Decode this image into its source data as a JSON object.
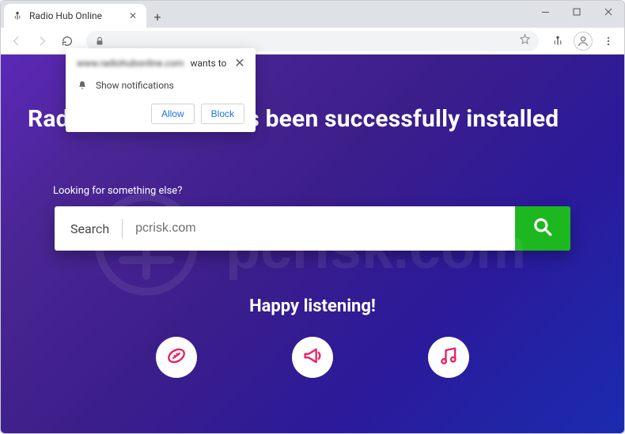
{
  "browser": {
    "tab_title": "Radio Hub Online",
    "newtab_glyph": "+",
    "win_min": "—",
    "win_max": "▢",
    "win_close": "✕",
    "tab_close": "✕",
    "url": ""
  },
  "notification": {
    "site": "www.radiohubonline.com",
    "wants_to": "wants to",
    "permission_label": "Show notifications",
    "allow": "Allow",
    "block": "Block",
    "close": "✕"
  },
  "page": {
    "headline": "Radio Hub Online has been successfully installed",
    "looking": "Looking for something else?",
    "search_label": "Search",
    "search_value": "pcrisk.com",
    "happy": "Happy listening!",
    "icons": [
      {
        "name": "football-icon",
        "color": "#ec1f65"
      },
      {
        "name": "megaphone-icon",
        "color": "#ec1f65"
      },
      {
        "name": "music-note-icon",
        "color": "#ec1f65"
      }
    ],
    "search_button_color": "#1DB720"
  },
  "watermark_text": "pcrisk.com"
}
